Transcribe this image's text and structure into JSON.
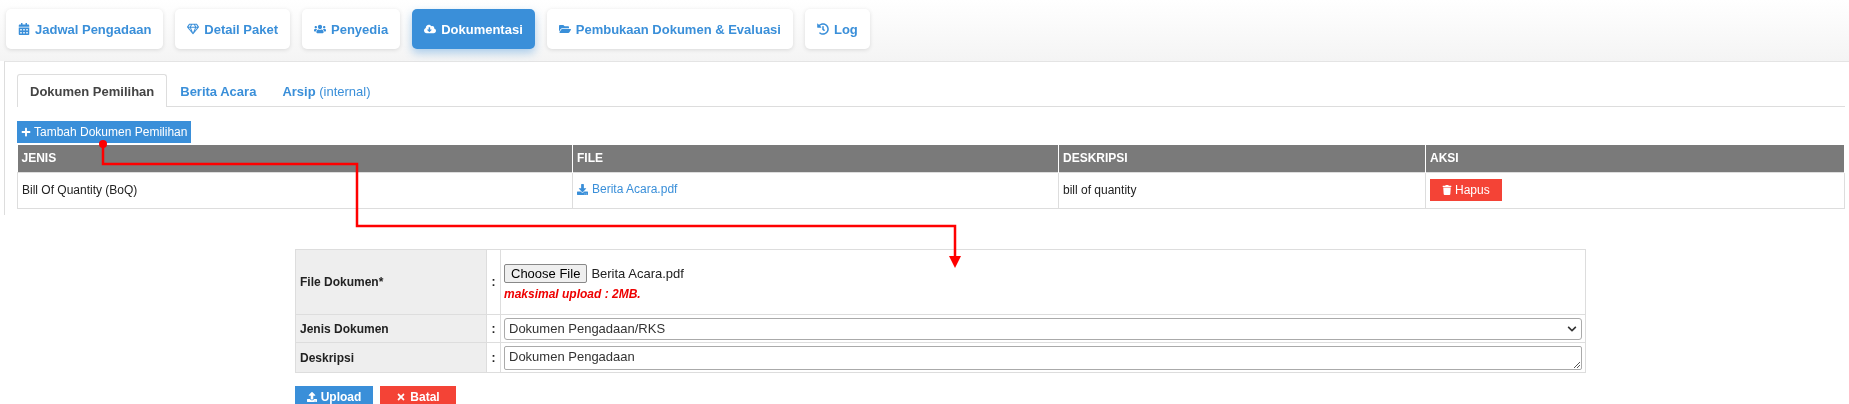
{
  "nav_tabs": [
    {
      "label": "Jadwal Pengadaan",
      "selected": false
    },
    {
      "label": "Detail Paket",
      "selected": false
    },
    {
      "label": "Penyedia",
      "selected": false
    },
    {
      "label": "Dokumentasi",
      "selected": true
    },
    {
      "label": "Pembukaan Dokumen & Evaluasi",
      "selected": false
    },
    {
      "label": "Log",
      "selected": false
    }
  ],
  "sub_tabs": [
    {
      "label": "Dokumen Pemilihan",
      "selected": true
    },
    {
      "label": "Berita Acara",
      "selected": false
    },
    {
      "label": "Arsip",
      "note": "(internal)",
      "selected": false
    }
  ],
  "add_button": "Tambah Dokumen Pemilihan",
  "table": {
    "columns": [
      "JENIS",
      "FILE",
      "DESKRIPSI",
      "AKSI"
    ],
    "rows": [
      {
        "jenis": "Bill Of Quantity (BoQ)",
        "file": "Berita Acara.pdf",
        "deskripsi": "bill of quantity",
        "action": "Hapus"
      }
    ]
  },
  "form": {
    "rows": [
      {
        "kind": "file",
        "label": "File Dokumen*",
        "separator": ":",
        "button": "Choose File",
        "value": "Berita Acara.pdf",
        "hint": "maksimal upload : 2MB."
      },
      {
        "kind": "select",
        "label": "Jenis Dokumen",
        "separator": ":",
        "value": "Dokumen Pengadaan/RKS"
      },
      {
        "kind": "textarea",
        "label": "Deskripsi",
        "separator": ":",
        "value": "Dokumen Pengadaan"
      }
    ],
    "buttons": [
      {
        "label": "Upload",
        "kind": "upload"
      },
      {
        "label": "Batal",
        "kind": "cancel"
      }
    ]
  }
}
